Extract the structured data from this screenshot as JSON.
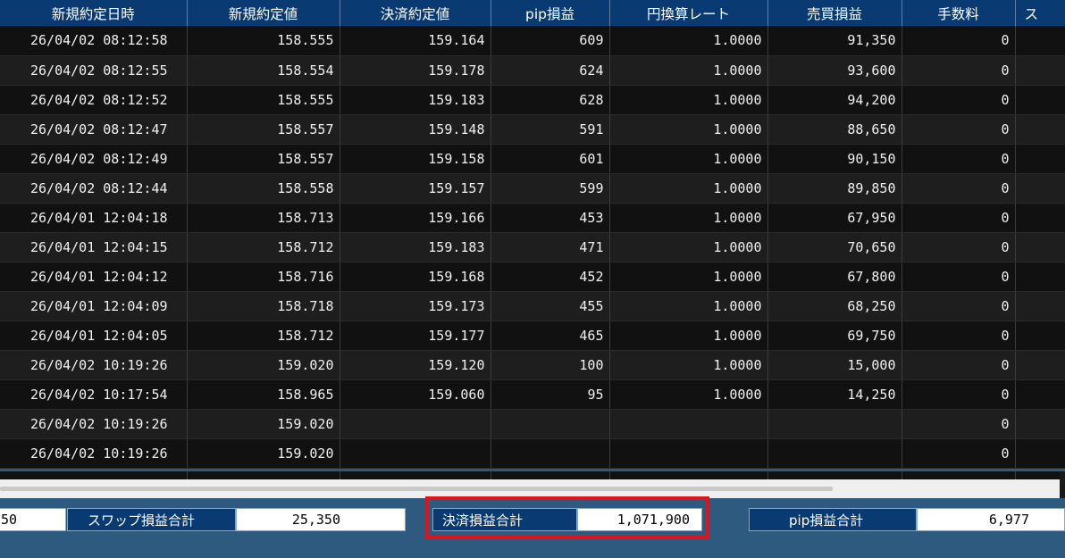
{
  "table": {
    "columns": [
      "新規約定日時",
      "新規約定値",
      "決済約定値",
      "pip損益",
      "円換算レート",
      "売買損益",
      "手数料",
      "ス"
    ],
    "rows": [
      [
        "26/04/02 08:12:58",
        "158.555",
        "159.164",
        "609",
        "1.0000",
        "91,350",
        "0",
        ""
      ],
      [
        "26/04/02 08:12:55",
        "158.554",
        "159.178",
        "624",
        "1.0000",
        "93,600",
        "0",
        ""
      ],
      [
        "26/04/02 08:12:52",
        "158.555",
        "159.183",
        "628",
        "1.0000",
        "94,200",
        "0",
        ""
      ],
      [
        "26/04/02 08:12:47",
        "158.557",
        "159.148",
        "591",
        "1.0000",
        "88,650",
        "0",
        ""
      ],
      [
        "26/04/02 08:12:49",
        "158.557",
        "159.158",
        "601",
        "1.0000",
        "90,150",
        "0",
        ""
      ],
      [
        "26/04/02 08:12:44",
        "158.558",
        "159.157",
        "599",
        "1.0000",
        "89,850",
        "0",
        ""
      ],
      [
        "26/04/01 12:04:18",
        "158.713",
        "159.166",
        "453",
        "1.0000",
        "67,950",
        "0",
        ""
      ],
      [
        "26/04/01 12:04:15",
        "158.712",
        "159.183",
        "471",
        "1.0000",
        "70,650",
        "0",
        ""
      ],
      [
        "26/04/01 12:04:12",
        "158.716",
        "159.168",
        "452",
        "1.0000",
        "67,800",
        "0",
        ""
      ],
      [
        "26/04/01 12:04:09",
        "158.718",
        "159.173",
        "455",
        "1.0000",
        "68,250",
        "0",
        ""
      ],
      [
        "26/04/01 12:04:05",
        "158.712",
        "159.177",
        "465",
        "1.0000",
        "69,750",
        "0",
        ""
      ],
      [
        "26/04/02 10:19:26",
        "159.020",
        "159.120",
        "100",
        "1.0000",
        "15,000",
        "0",
        ""
      ],
      [
        "26/04/02 10:17:54",
        "158.965",
        "159.060",
        "95",
        "1.0000",
        "14,250",
        "0",
        ""
      ],
      [
        "26/04/02 10:19:26",
        "159.020",
        "",
        "",
        "",
        "",
        "0",
        ""
      ],
      [
        "26/04/02 10:19:26",
        "159.020",
        "",
        "",
        "",
        "",
        "0",
        ""
      ]
    ]
  },
  "totals": {
    "left_cut_value": "50",
    "swap_label": "スワップ損益合計",
    "swap_value": "25,350",
    "settle_label": "決済損益合計",
    "settle_value": "1,071,900",
    "pip_label": "pip損益合計",
    "pip_value": "6,977"
  },
  "colors": {
    "header_bg": "#0a3a72",
    "footer_bg": "#2f5a80",
    "highlight": "#e0121b"
  }
}
